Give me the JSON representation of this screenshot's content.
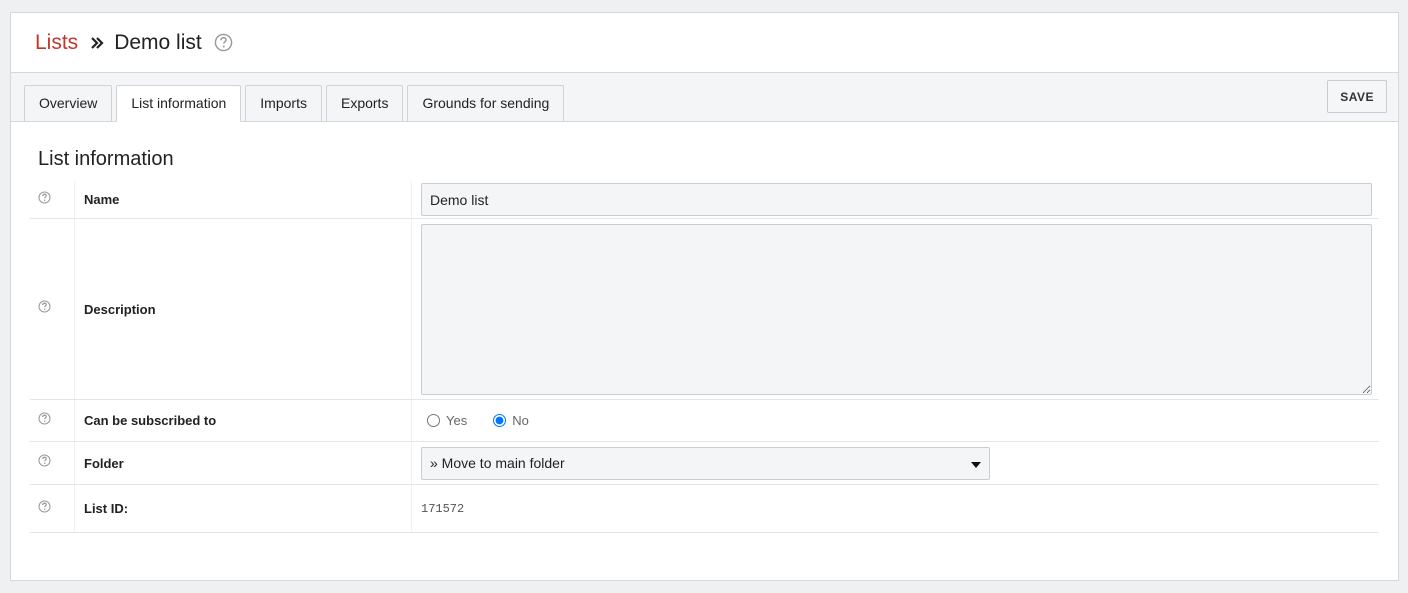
{
  "breadcrumb": {
    "parent": "Lists",
    "current": "Demo list",
    "separator_icon": "double-chevron-right-icon",
    "help_icon": "question-circle-icon"
  },
  "tabs": [
    {
      "label": "Overview",
      "active": false
    },
    {
      "label": "List information",
      "active": true
    },
    {
      "label": "Imports",
      "active": false
    },
    {
      "label": "Exports",
      "active": false
    },
    {
      "label": "Grounds for sending",
      "active": false
    }
  ],
  "toolbar": {
    "save_label": "SAVE"
  },
  "section": {
    "title": "List information"
  },
  "form": {
    "name": {
      "label": "Name",
      "value": "Demo list"
    },
    "description": {
      "label": "Description",
      "value": ""
    },
    "subscribable": {
      "label": "Can be subscribed to",
      "options": [
        "Yes",
        "No"
      ],
      "selected": "No"
    },
    "folder": {
      "label": "Folder",
      "value": "» Move to main folder"
    },
    "list_id": {
      "label": "List ID:",
      "value": "171572"
    }
  },
  "colors": {
    "accent": "#c0392b",
    "background": "#eef0f2",
    "input_bg": "#f3f5f7"
  }
}
